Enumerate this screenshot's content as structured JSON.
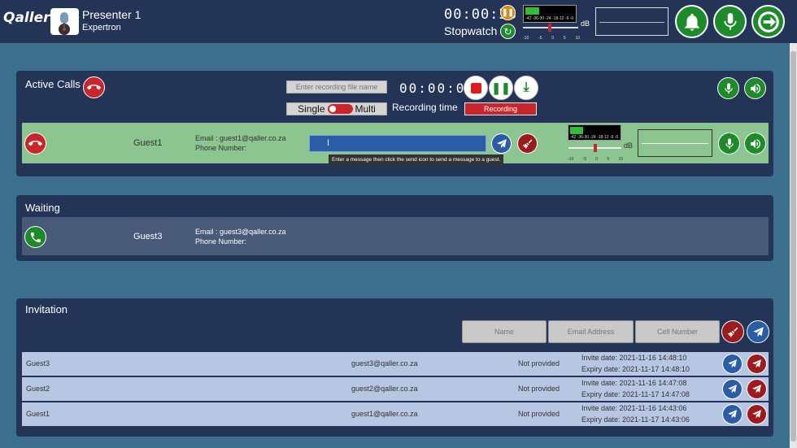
{
  "header": {
    "logo": "Qaller",
    "presenter_name": "Presenter 1",
    "company": "Expertron",
    "timer": "00:00:58",
    "stopwatch_label": "Stopwatch",
    "meter_labels": "-42 -36-30 -24 -18-12  -6  -0",
    "scale": [
      "-10",
      "-5",
      "0",
      "5",
      "10"
    ],
    "db_label": "dB"
  },
  "active_calls": {
    "title": "Active Calls",
    "recording_placeholder": "Enter recording file name",
    "recording_timer": "00:00:00",
    "mode_single": "Single",
    "mode_multi": "Multi",
    "recording_time_label": "Recording time",
    "recording_status": "Recording",
    "call": {
      "guest": "Guest1",
      "email": "Email : guest1@qaller.co.za",
      "phone": "Phone Number:",
      "tooltip": "Enter a message then click the send icon to send a message to a guest."
    }
  },
  "waiting": {
    "title": "Waiting",
    "guest": "Guest3",
    "email": "Email : guest3@qaller.co.za",
    "phone": "Phone Number:"
  },
  "invitation": {
    "title": "Invitation",
    "name_placeholder": "Name",
    "email_placeholder": "Email Address",
    "cell_placeholder": "Cell Number",
    "rows": [
      {
        "name": "Guest3",
        "email": "guest3@qaller.co.za",
        "cell": "Not provided",
        "invite": "Invite date:  2021-11-16 14:48:10",
        "expiry": "Expiry date: 2021-11-17 14:48:10"
      },
      {
        "name": "Guest2",
        "email": "guest2@qaller.co.za",
        "cell": "Not provided",
        "invite": "Invite date:  2021-11-16 14:47:08",
        "expiry": "Expiry date: 2021-11-17 14:47:08"
      },
      {
        "name": "Guest1",
        "email": "guest1@qaller.co.za",
        "cell": "Not provided",
        "invite": "Invite date:  2021-11-16 14:43:06",
        "expiry": "Expiry date: 2021-11-17 14:43:06"
      }
    ]
  },
  "colors": {
    "topbar": "#233457",
    "background": "#3c6e8e",
    "active_row": "#8cc58f",
    "waiting_row": "#485a78",
    "invite_row": "#b7c6e2",
    "record_red": "#c9252c",
    "accent_green": "#1e8a2c",
    "send_blue": "#2a5da6"
  },
  "icons": {
    "bell": "bell-icon",
    "mic": "microphone-icon",
    "exit": "exit-icon",
    "hangup": "phone-hangup-icon",
    "answer": "phone-answer-icon",
    "send": "paper-plane-icon",
    "clear": "broom-icon",
    "speaker": "speaker-icon",
    "stop": "stop-icon",
    "pause": "pause-icon",
    "download": "download-icon",
    "reset": "refresh-icon"
  }
}
